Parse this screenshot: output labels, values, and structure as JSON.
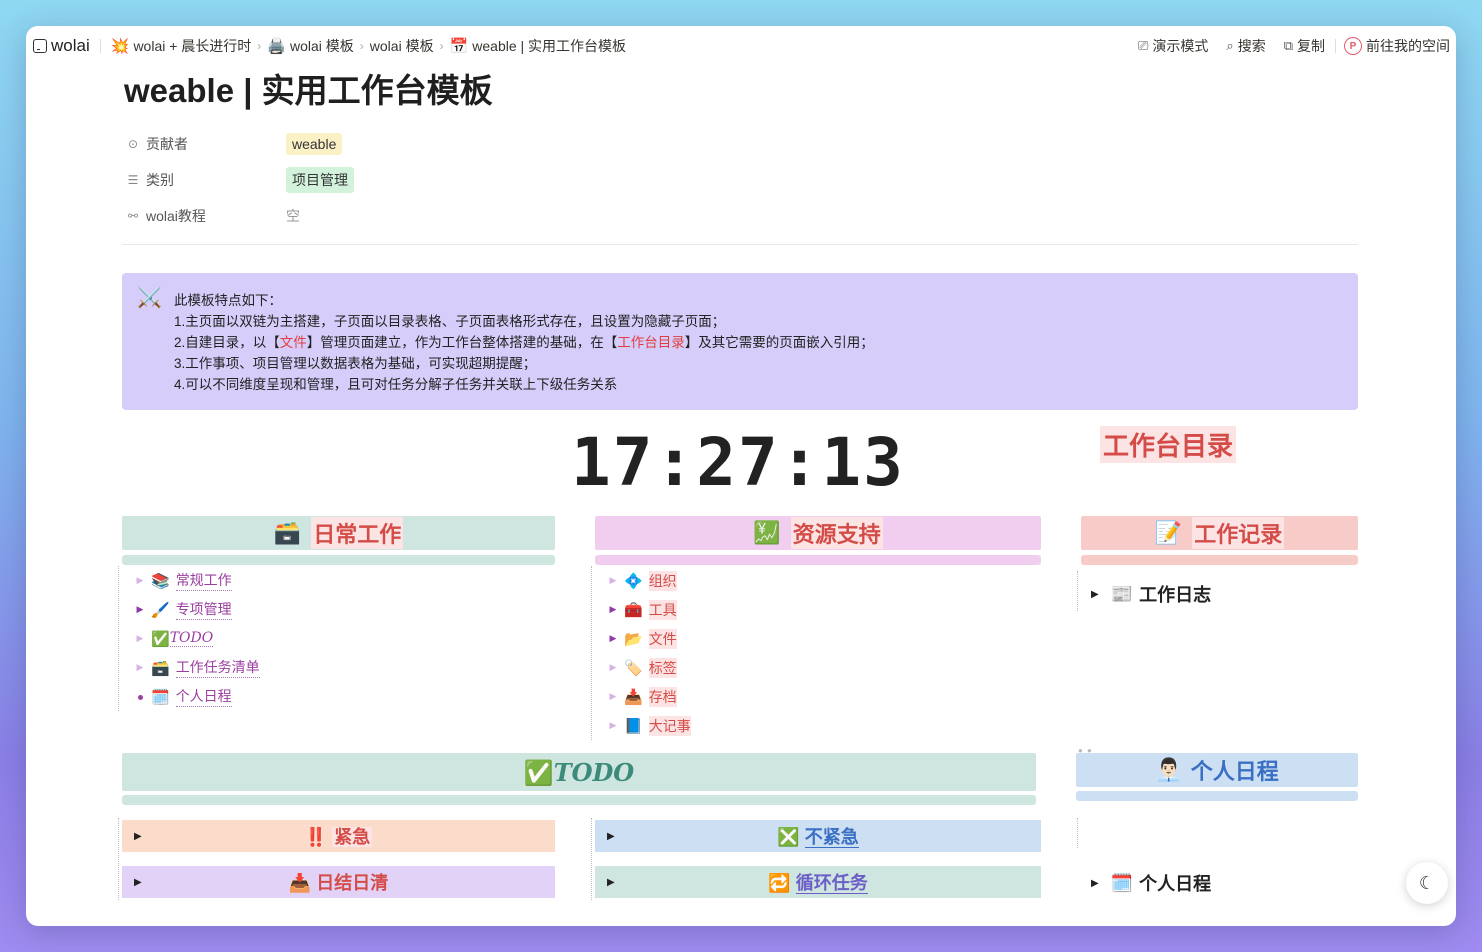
{
  "app": {
    "name": "wolai"
  },
  "breadcrumb": [
    {
      "icon": "💥",
      "label": "wolai + 晨长进行时"
    },
    {
      "icon": "🖨️",
      "label": "wolai 模板"
    },
    {
      "icon": "",
      "label": "wolai 模板"
    },
    {
      "icon": "📅",
      "label": "weable | 实用工作台模板"
    }
  ],
  "actions": {
    "present": "演示模式",
    "search": "搜索",
    "copy": "复制",
    "avatar": "P",
    "goto": "前往我的空间"
  },
  "page": {
    "title": "weable | 实用工作台模板"
  },
  "props": [
    {
      "key": "贡献者",
      "icon": "contributor-icon",
      "value": "weable"
    },
    {
      "key": "类别",
      "icon": "list-icon",
      "value": "项目管理"
    },
    {
      "key": "wolai教程",
      "icon": "link-icon",
      "value": "空"
    }
  ],
  "callout": {
    "icon": "⚔️",
    "line1": "此模板特点如下：",
    "line2": "1.主页面以双链为主搭建，子页面以目录表格、子页面表格形式存在，且设置为隐藏子页面；",
    "line3_a": "2.自建目录，以【",
    "line3_b": "文件",
    "line3_c": "】管理页面建立，作为工作台整体搭建的基础，在【",
    "line3_d": "工作台目录",
    "line3_e": "】及其它需要的页面嵌入引用；",
    "line4": "3.工作事项、项目管理以数据表格为基础，可实现超期提醒；",
    "line5": "4.可以不同维度呈现和管理，且可对任务分解子任务并关联上下级任务关系"
  },
  "clock": {
    "time": "17:27:13"
  },
  "workbench_dir": "工作台目录",
  "daily": {
    "icon": "🗃️",
    "title": "日常工作",
    "items": [
      {
        "icon": "📚",
        "label": "常规工作"
      },
      {
        "icon": "🖌️",
        "label": "专项管理"
      },
      {
        "icon": "✅",
        "label": "TODO"
      },
      {
        "icon": "🗃️",
        "label": "工作任务清单"
      },
      {
        "icon": "🗓️",
        "label": "个人日程"
      }
    ]
  },
  "resource": {
    "icon": "💹",
    "title": "资源支持",
    "items": [
      {
        "icon": "💠",
        "label": "组织"
      },
      {
        "icon": "🧰",
        "label": "工具"
      },
      {
        "icon": "📂",
        "label": "文件"
      },
      {
        "icon": "🏷️",
        "label": "标签"
      },
      {
        "icon": "📥",
        "label": "存档"
      },
      {
        "icon": "📘",
        "label": "大记事"
      }
    ]
  },
  "record": {
    "icon": "📝",
    "title": "工作记录",
    "toggle_icon": "📰",
    "toggle_label": "工作日志"
  },
  "todo": {
    "icon": "✅",
    "title": "TODO"
  },
  "schedule": {
    "icon": "👨🏻‍💼",
    "title": "个人日程",
    "toggle_icon": "🗓️",
    "toggle_label": "个人日程"
  },
  "subsections": {
    "urgent": {
      "icon": "‼️",
      "label": "紧急"
    },
    "not_urgent": {
      "icon": "❎",
      "label": "不紧急"
    },
    "daily_clear": {
      "icon": "📥",
      "label": "日结日清"
    },
    "recurring": {
      "icon": "🔁",
      "label": "循环任务"
    }
  },
  "colors": {
    "accent_red": "#d44c47",
    "callout_bg": "#d6cdfa",
    "link_purple": "#9b3fa0"
  }
}
